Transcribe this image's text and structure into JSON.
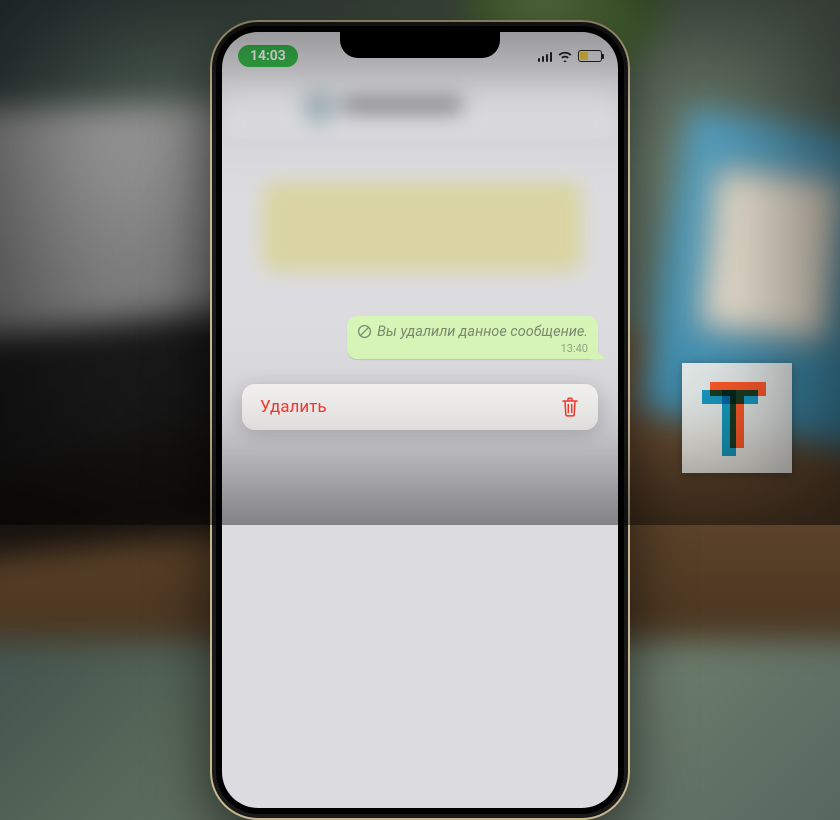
{
  "status": {
    "time": "14:03"
  },
  "message": {
    "deleted_text": "Вы удалили данное сообщение.",
    "time": "13:40"
  },
  "action": {
    "delete_label": "Удалить"
  }
}
